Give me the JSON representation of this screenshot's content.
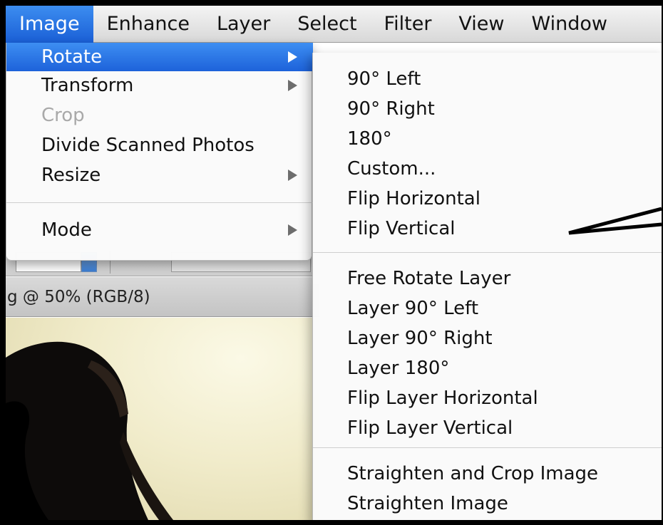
{
  "menubar": {
    "items": [
      "Image",
      "Enhance",
      "Layer",
      "Select",
      "Filter",
      "View",
      "Window"
    ],
    "active_index": 0
  },
  "document": {
    "title": "g @ 50% (RGB/8)"
  },
  "image_menu": {
    "items": [
      {
        "label": "Rotate",
        "submenu": true,
        "highlighted": true,
        "enabled": true
      },
      {
        "label": "Transform",
        "submenu": true,
        "highlighted": false,
        "enabled": true
      },
      {
        "label": "Crop",
        "submenu": false,
        "highlighted": false,
        "enabled": false
      },
      {
        "label": "Divide Scanned Photos",
        "submenu": false,
        "highlighted": false,
        "enabled": true
      },
      {
        "label": "Resize",
        "submenu": true,
        "highlighted": false,
        "enabled": true
      },
      {
        "label": "Mode",
        "submenu": true,
        "highlighted": false,
        "enabled": true
      }
    ]
  },
  "rotate_submenu": {
    "groups": [
      [
        "90° Left",
        "90° Right",
        "180°",
        "Custom...",
        "Flip Horizontal",
        "Flip Vertical"
      ],
      [
        "Free Rotate Layer",
        "Layer 90° Left",
        "Layer 90° Right",
        "Layer 180°",
        "Flip Layer Horizontal",
        "Flip Layer Vertical"
      ],
      [
        "Straighten and Crop Image",
        "Straighten Image"
      ]
    ]
  },
  "colors": {
    "highlight": "#1d62da",
    "disabled_text": "#a9a9a9",
    "frame": "#000000"
  }
}
